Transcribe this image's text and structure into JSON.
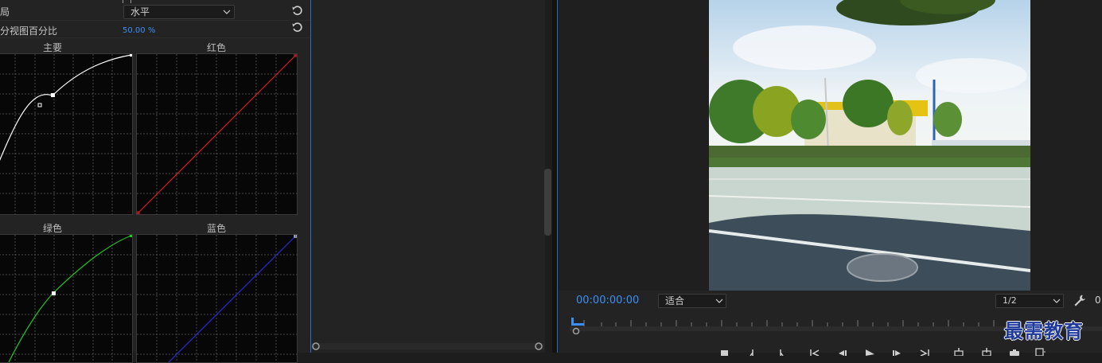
{
  "effect_controls": {
    "layout_label": "局",
    "layout_value": "水平",
    "split_label": "分视图百分比",
    "split_value": "50.00",
    "split_unit": "%"
  },
  "curves": {
    "master_title": "主要",
    "red_title": "红色",
    "green_title": "绿色",
    "blue_title": "蓝色"
  },
  "program_monitor": {
    "timecode": "00:00:00:00",
    "fit_value": "适合",
    "resolution_value": "1/2",
    "right_edge_digit": "0"
  },
  "watermark": "最需教育",
  "colors": {
    "accent": "#3d8ff5",
    "master_curve": "#ffffff",
    "red_curve": "#d42020",
    "green_curve": "#22c51e",
    "blue_curve": "#2a2ad8"
  },
  "icons": [
    "reset-icon",
    "chevron-down-icon",
    "wrench-icon",
    "stop-icon",
    "mark-in-icon",
    "mark-out-icon",
    "go-to-in-icon",
    "step-back-icon",
    "play-icon",
    "step-forward-icon",
    "go-to-out-icon",
    "insert-icon",
    "overwrite-icon",
    "export-frame-icon",
    "button-editor-icon"
  ]
}
